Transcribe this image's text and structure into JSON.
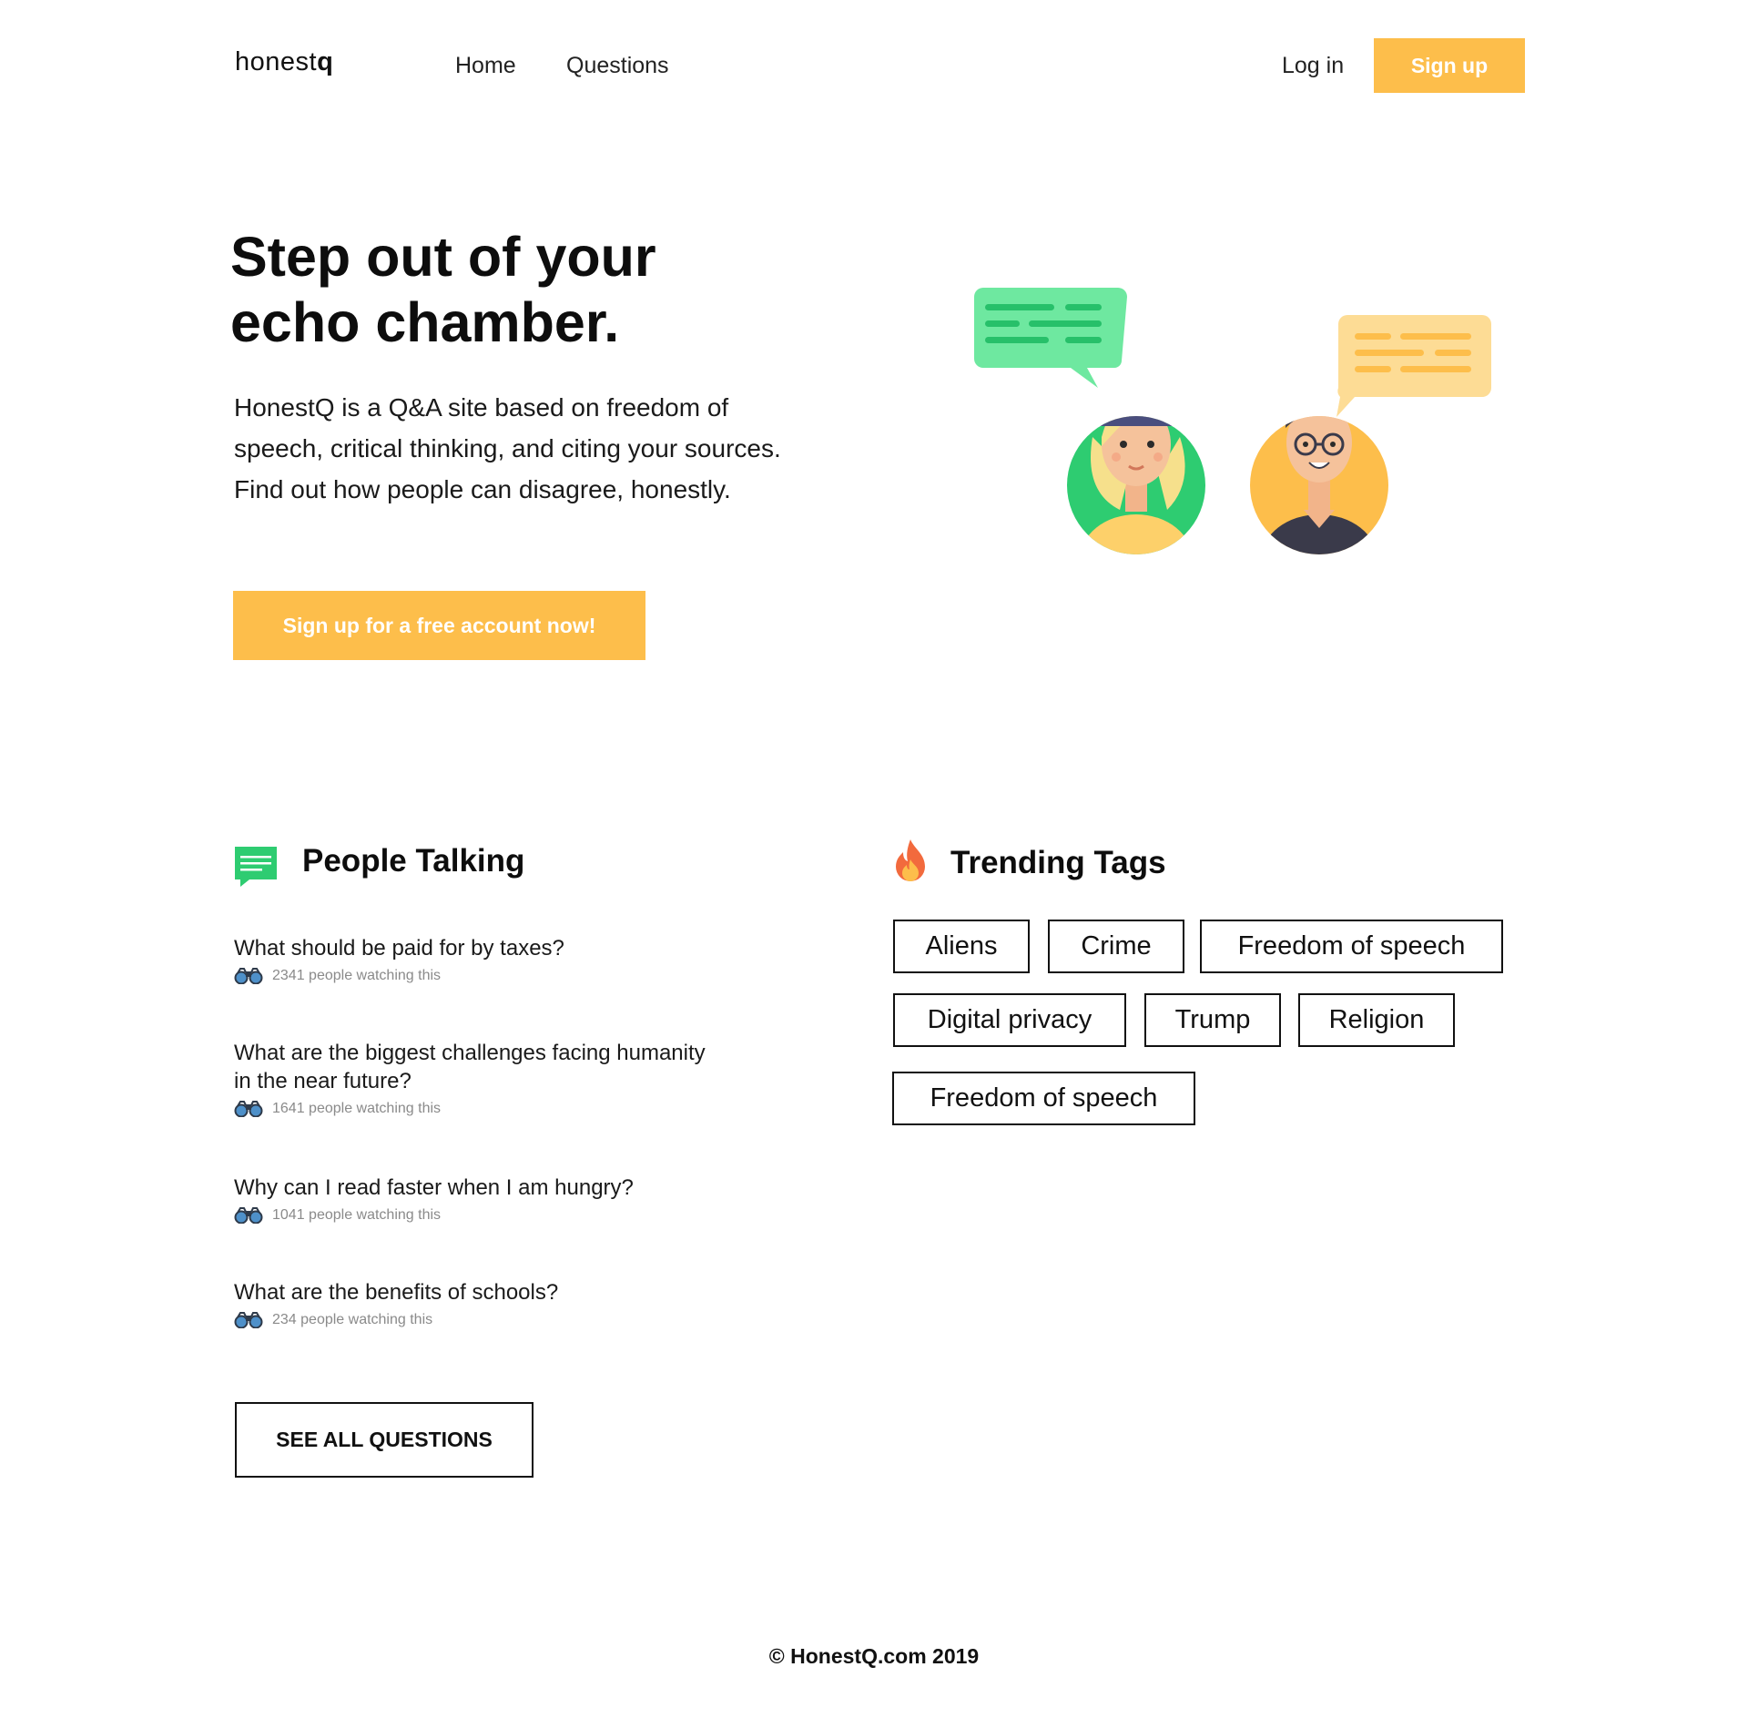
{
  "header": {
    "logo_light": "honest",
    "logo_bold": "q",
    "nav": [
      "Home",
      "Questions"
    ],
    "login_label": "Log in",
    "signup_label": "Sign up"
  },
  "hero": {
    "title_line1": "Step out of your",
    "title_line2": "echo chamber.",
    "desc_line1": "HonestQ is a Q&A site based on freedom of",
    "desc_line2": "speech, critical thinking, and citing your sources.",
    "desc_line3": "Find out how people can disagree, honestly.",
    "cta_label": "Sign up for a free account now!"
  },
  "people_talking": {
    "title": "People Talking",
    "icon": "chat-bubble-icon",
    "questions": [
      {
        "text": "What should be paid for by taxes?",
        "meta": "2341 people watching this"
      },
      {
        "text_line1": "What are the biggest challenges facing humanity",
        "text_line2": "in the near future?",
        "meta": "1641 people watching this"
      },
      {
        "text": "Why can I read faster when I am hungry?",
        "meta": "1041 people watching this"
      },
      {
        "text": "What are the benefits of schools?",
        "meta": "234 people watching this"
      }
    ],
    "see_all_label": "SEE ALL QUESTIONS"
  },
  "trending_tags": {
    "title": "Trending Tags",
    "icon": "fire-icon",
    "tags": [
      "Aliens",
      "Crime",
      "Freedom of speech",
      "Digital privacy",
      "Trump",
      "Religion",
      "Freedom of speech"
    ]
  },
  "footer": {
    "copyright": "© HonestQ.com 2019"
  },
  "colors": {
    "accent": "#fdbe4b",
    "green": "#2ecc71",
    "bubble_green": "#6ee8a0",
    "bubble_yellow": "#fddc95"
  }
}
